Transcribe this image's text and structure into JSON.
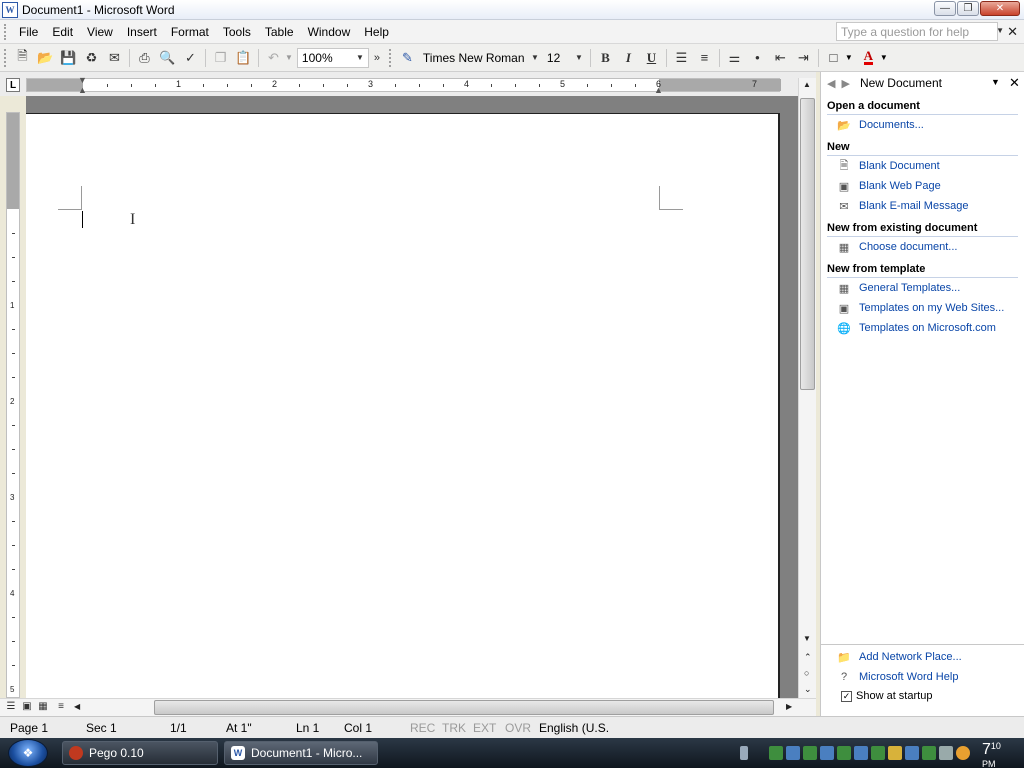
{
  "window": {
    "title": "Document1 - Microsoft Word",
    "app_icon": "W"
  },
  "menu": {
    "items": [
      "File",
      "Edit",
      "View",
      "Insert",
      "Format",
      "Tools",
      "Table",
      "Window",
      "Help"
    ],
    "help_placeholder": "Type a question for help"
  },
  "toolbar": {
    "zoom": "100%",
    "font_name": "Times New Roman",
    "font_size": "12",
    "bold": "B",
    "italic": "I",
    "underline": "U",
    "font_color_glyph": "A",
    "font_color": "#e00000"
  },
  "ruler": {
    "tab_selector": "L",
    "h_numbers": [
      "1",
      "2",
      "3",
      "4",
      "5",
      "6",
      "7"
    ],
    "v_numbers": [
      "1",
      "2",
      "3",
      "4",
      "5"
    ]
  },
  "taskpane": {
    "title": "New Document",
    "sections": [
      {
        "heading": "Open a document",
        "links": [
          {
            "label": "Documents...",
            "icon": "folder-icon"
          }
        ]
      },
      {
        "heading": "New",
        "links": [
          {
            "label": "Blank Document",
            "icon": "blank-doc-icon"
          },
          {
            "label": "Blank Web Page",
            "icon": "web-page-icon"
          },
          {
            "label": "Blank E-mail Message",
            "icon": "email-icon"
          }
        ]
      },
      {
        "heading": "New from existing document",
        "links": [
          {
            "label": "Choose document...",
            "icon": "word-doc-icon"
          }
        ]
      },
      {
        "heading": "New from template",
        "links": [
          {
            "label": "General Templates...",
            "icon": "word-doc-icon"
          },
          {
            "label": "Templates on my Web Sites...",
            "icon": "web-template-icon"
          },
          {
            "label": "Templates on Microsoft.com",
            "icon": "globe-icon"
          }
        ]
      }
    ],
    "bottom_links": [
      {
        "label": "Add Network Place...",
        "icon": "network-folder-icon"
      },
      {
        "label": "Microsoft Word Help",
        "icon": "help-icon"
      }
    ],
    "show_at_startup": "Show at startup",
    "show_at_startup_checked": true
  },
  "status": {
    "page": "Page 1",
    "sec": "Sec 1",
    "pages": "1/1",
    "at": "At 1\"",
    "ln": "Ln 1",
    "col": "Col 1",
    "rec": "REC",
    "trk": "TRK",
    "ext": "EXT",
    "ovr": "OVR",
    "language": "English (U.S."
  },
  "taskbar": {
    "buttons": [
      {
        "label": "Pego 0.10",
        "icon": "pego-icon"
      },
      {
        "label": "Document1 - Micro...",
        "icon": "word-icon"
      }
    ],
    "clock_hour": "7",
    "clock_min": "10",
    "clock_ampm": "PM"
  }
}
